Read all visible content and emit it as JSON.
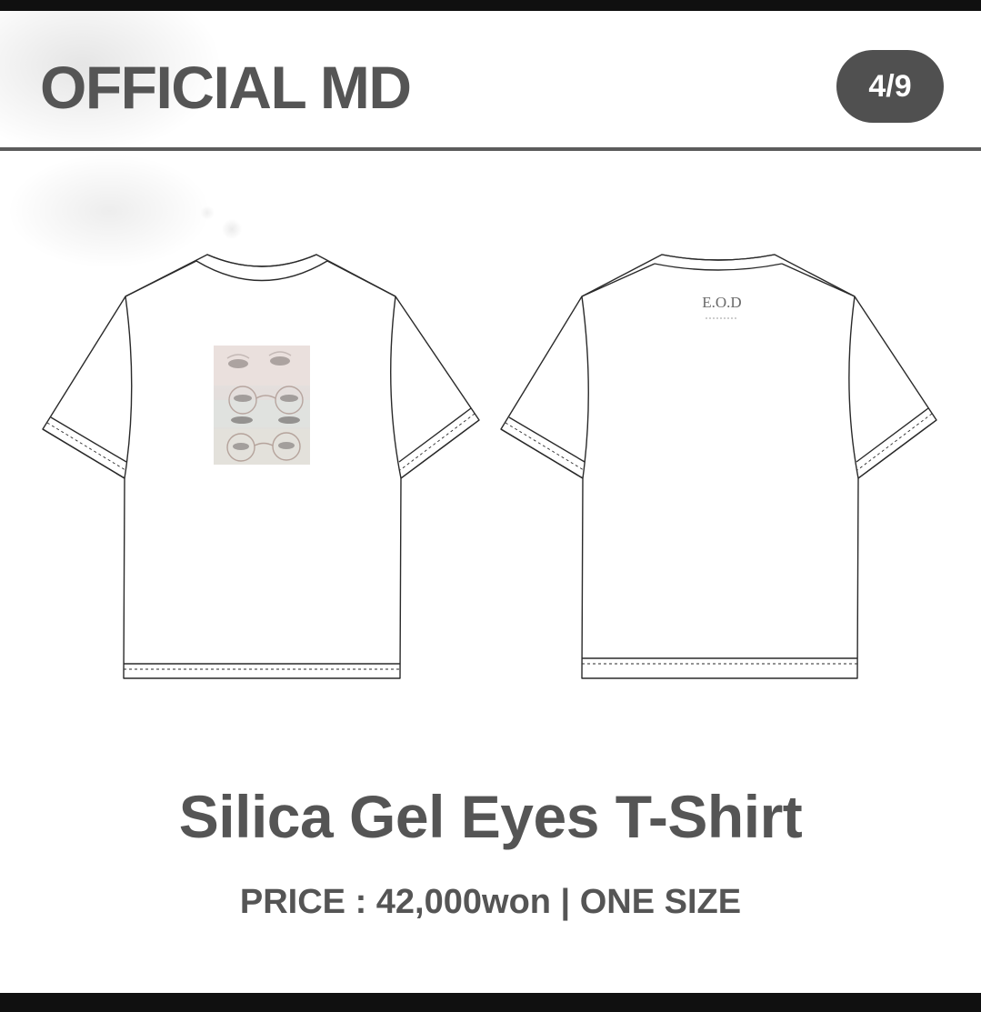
{
  "header": {
    "title": "OFFICIAL MD",
    "page_indicator": "4/9"
  },
  "product": {
    "name": "Silica Gel Eyes T-Shirt",
    "price_label": "PRICE : 42,000won | ONE SIZE",
    "back_print_logo": "E.O.D"
  },
  "colors": {
    "text": "#555555",
    "pill": "#505050",
    "frame": "#101010"
  }
}
